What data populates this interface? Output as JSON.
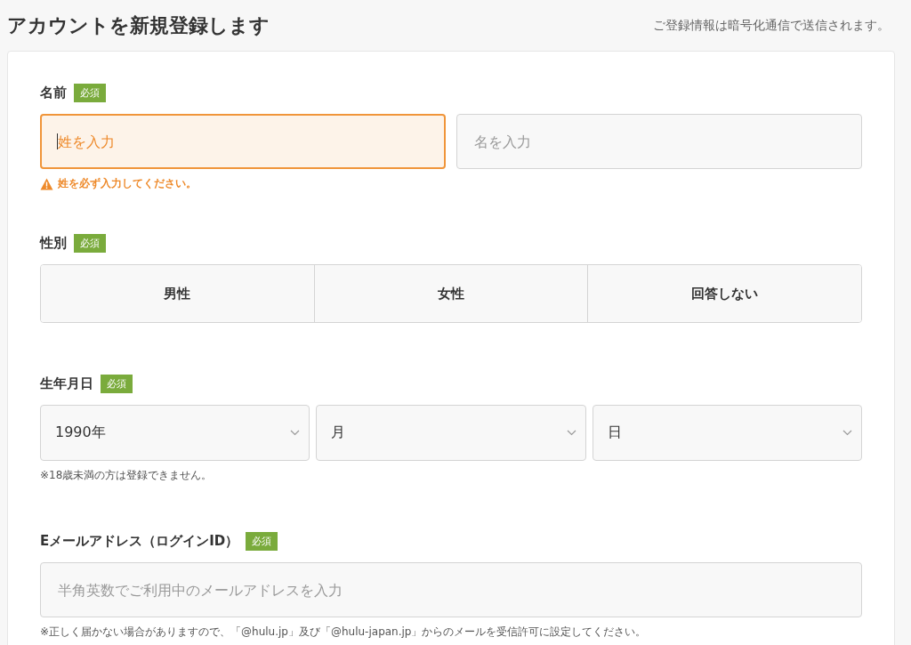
{
  "header": {
    "title": "アカウントを新規登録します",
    "note": "ご登録情報は暗号化通信で送信されます。"
  },
  "sections": [
    {
      "kind": "name",
      "label": "名前",
      "required_badge": "必須",
      "fields": [
        {
          "placeholder": "姓を入力",
          "error": true,
          "focused": true
        },
        {
          "placeholder": "名を入力",
          "error": false,
          "focused": false
        }
      ],
      "error_message": "姓を必ず入力してください。"
    },
    {
      "kind": "choice",
      "label": "性別",
      "required_badge": "必須",
      "options": [
        {
          "label": "男性",
          "selected": false
        },
        {
          "label": "女性",
          "selected": false
        },
        {
          "label": "回答しない",
          "selected": false
        }
      ]
    },
    {
      "kind": "date",
      "label": "生年月日",
      "required_badge": "必須",
      "selects": [
        {
          "value": "1990年"
        },
        {
          "value": "月"
        },
        {
          "value": "日"
        }
      ],
      "note": "※18歳未満の方は登録できません。"
    },
    {
      "kind": "email",
      "label": "Eメールアドレス（ログインID）",
      "required_badge": "必須",
      "placeholder": "半角英数でご利用中のメールアドレスを入力",
      "note": "※正しく届かない場合がありますので、「@hulu.jp」及び「@hulu-japan.jp」からのメールを受信許可に設定してください。"
    }
  ]
}
